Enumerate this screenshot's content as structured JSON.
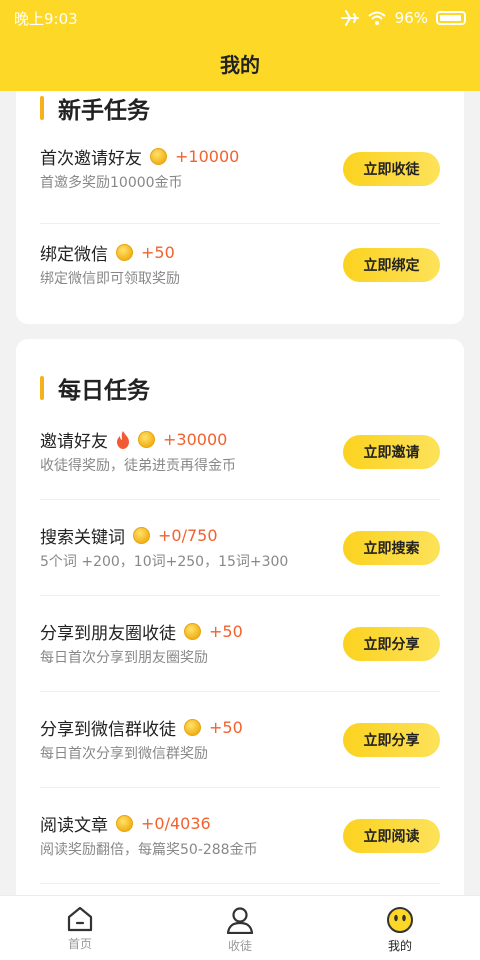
{
  "status_bar": {
    "time": "晚上9:03",
    "battery": "96%"
  },
  "page_title": "我的",
  "newbie": {
    "title": "新手任务",
    "tasks": [
      {
        "name": "首次邀请好友",
        "reward": "+10000",
        "desc": "首邀多奖励10000金币",
        "button": "立即收徒"
      },
      {
        "name": "绑定微信",
        "reward": "+50",
        "desc": "绑定微信即可领取奖励",
        "button": "立即绑定"
      }
    ]
  },
  "daily": {
    "title": "每日任务",
    "tasks": [
      {
        "name": "邀请好友",
        "reward": "+30000",
        "desc": "收徒得奖励，徒弟进贡再得金币",
        "button": "立即邀请",
        "hot": true
      },
      {
        "name": "搜索关键词",
        "reward": "+0/750",
        "desc": "5个词 +200，10词+250，15词+300",
        "button": "立即搜索"
      },
      {
        "name": "分享到朋友圈收徒",
        "reward": "+50",
        "desc": "每日首次分享到朋友圈奖励",
        "button": "立即分享"
      },
      {
        "name": "分享到微信群收徒",
        "reward": "+50",
        "desc": "每日首次分享到微信群奖励",
        "button": "立即分享"
      },
      {
        "name": "阅读文章",
        "reward": "+0/4036",
        "desc": "阅读奖励翻倍，每篇奖50-288金币",
        "button": "立即阅读"
      }
    ]
  },
  "tabbar": [
    {
      "label": "首页",
      "icon": "home-icon"
    },
    {
      "label": "收徒",
      "icon": "user-icon"
    },
    {
      "label": "我的",
      "icon": "smiley-face-icon",
      "active": true
    }
  ],
  "colors": {
    "accent": "#fdd827",
    "reward": "#f1622e",
    "title_bar_marker": "#f6b21c"
  }
}
